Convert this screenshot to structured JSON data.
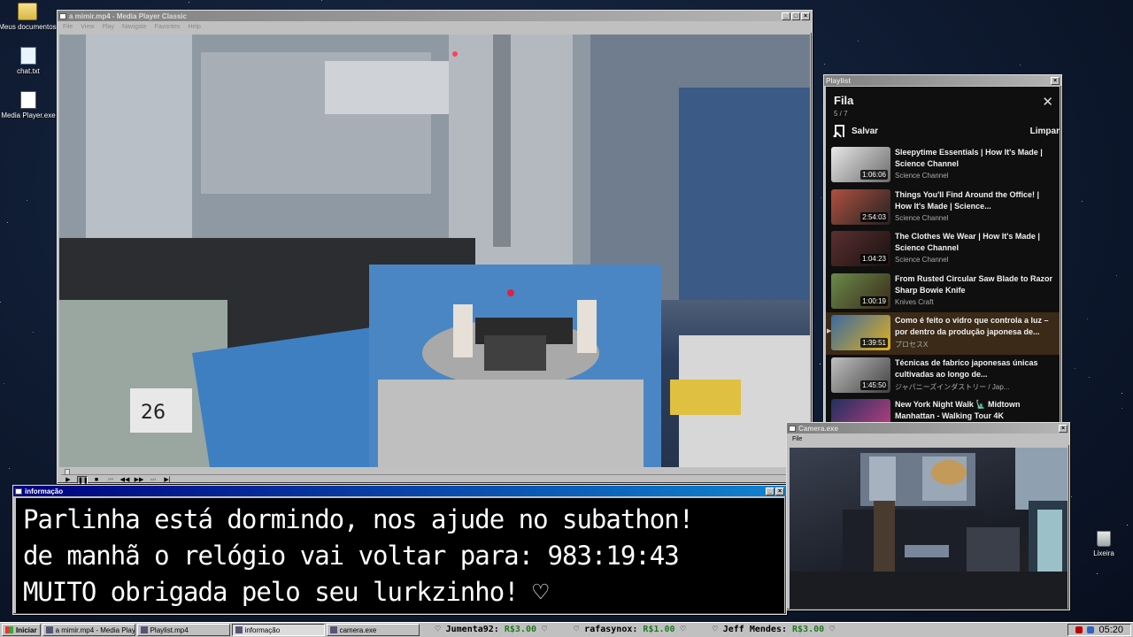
{
  "desktop": {
    "icons": [
      {
        "label": "Meus documentos",
        "icon": "folder-icon"
      },
      {
        "label": "chat.txt",
        "icon": "notepad-icon"
      },
      {
        "label": "Media Player.exe",
        "icon": "media-player-icon"
      },
      {
        "label": "Lixeira",
        "icon": "recycle-bin-icon"
      }
    ]
  },
  "media_player": {
    "title": "a mimir.mp4 - Media Player Classic",
    "menu": [
      "File",
      "View",
      "Play",
      "Navigate",
      "Favorites",
      "Help"
    ],
    "controls": [
      "▶",
      "❚❚",
      "■",
      "⏮",
      "◀◀",
      "▶▶",
      "⏭",
      "▶|"
    ],
    "volume_icon": "speaker-icon"
  },
  "info_window": {
    "title": "informação",
    "lines": [
      "Parlinha está dormindo, nos ajude no subathon!",
      "de manhã o relógio vai voltar para:  983:19:43",
      "MUITO obrigada pelo seu lurkzinho! ♡"
    ]
  },
  "playlist_window": {
    "title": "Playlist",
    "header": "Fila",
    "count": "5 / 7",
    "save_label": "Salvar",
    "clear_label": "Limpar",
    "items": [
      {
        "title": "Sleepytime Essentials | How It's Made | Science Channel",
        "channel": "Science Channel",
        "duration": "1:06:06",
        "current": false
      },
      {
        "title": "Things You'll Find Around the Office! | How It's Made | Science...",
        "channel": "Science Channel",
        "duration": "2:54:03",
        "current": false
      },
      {
        "title": "The Clothes We Wear | How It's Made | Science Channel",
        "channel": "Science Channel",
        "duration": "1:04:23",
        "current": false
      },
      {
        "title": "From Rusted Circular Saw Blade to Razor Sharp Bowie Knife",
        "channel": "Knives Craft",
        "duration": "1:00:19",
        "current": false
      },
      {
        "title": "Como é feito o vidro que controla a luz – por dentro da produção japonesa de...",
        "channel": "プロセスX",
        "duration": "1:39:51",
        "current": true
      },
      {
        "title": "Técnicas de fabrico japonesas únicas cultivadas ao longo de...",
        "channel": "ジャパニーズインダストリー / Jap...",
        "duration": "1:45:50",
        "current": false
      },
      {
        "title": "New York Night Walk 🗽 Midtown Manhattan - Walking Tour 4K",
        "channel": "",
        "duration": "",
        "current": false
      }
    ]
  },
  "camera_window": {
    "title": "Camera.exe",
    "menu": [
      "File"
    ]
  },
  "taskbar": {
    "start_label": "Iniciar",
    "tasks": [
      {
        "label": "a mimir.mp4 - Media Playe...",
        "active": false
      },
      {
        "label": "Playlist.mp4",
        "active": false
      },
      {
        "label": "informação",
        "active": true
      },
      {
        "label": "camera.exe",
        "active": false
      }
    ],
    "ticker": [
      {
        "name": "♡ Jumenta92:",
        "amount": "R$3.00",
        "tail": " ♡"
      },
      {
        "name": "♡ rafasynox:",
        "amount": "R$1.00",
        "tail": " ♡"
      },
      {
        "name": "♡ Jeff Mendes:",
        "amount": "R$3.00",
        "tail": " ♡"
      }
    ],
    "clock": "05:20"
  }
}
